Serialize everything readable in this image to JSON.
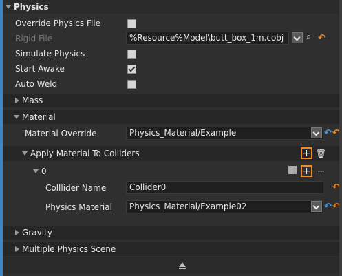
{
  "section_title": "Physics",
  "props": {
    "override_physics_file": "Override Physics File",
    "rigid_file": "Rigid File",
    "rigid_file_value": "%Resource%Model\\butt_box_1m.cobj",
    "simulate_physics": "Simulate Physics",
    "start_awake": "Start Awake",
    "auto_weld": "Auto Weld"
  },
  "groups": {
    "mass": "Mass",
    "material": "Material",
    "gravity": "Gravity",
    "multiple_physics_scene": "Multiple Physics Scene"
  },
  "material": {
    "override_label": "Material Override",
    "override_value": "Physics_Material/Example",
    "apply_label": "Apply Material To Colliders",
    "item_index": "0",
    "collider_name_label": "Colllider Name",
    "collider_name_value": "Collider0",
    "physics_material_label": "Physics Material",
    "physics_material_value": "Physics_Material/Example02"
  },
  "states": {
    "override_physics_file": false,
    "simulate_physics": false,
    "start_awake": true,
    "auto_weld": false
  },
  "colors": {
    "accent_blue": "#3b86c6",
    "highlight_orange": "#f08a24"
  },
  "icons": {
    "search": "⌕",
    "undo": "↶",
    "reset": "↶",
    "add": "+",
    "remove": "−",
    "trash": "🗑"
  }
}
